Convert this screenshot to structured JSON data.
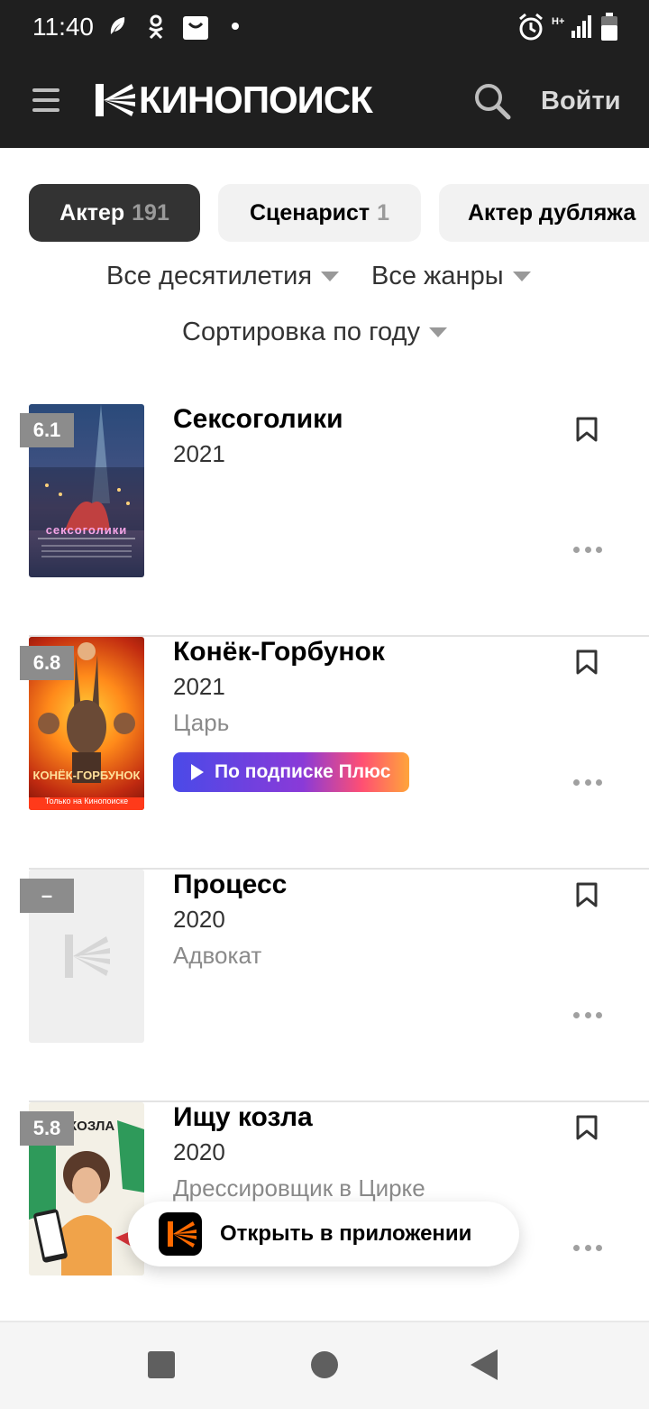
{
  "status_bar": {
    "time": "11:40"
  },
  "header": {
    "logo_text": "КИНОПОИСК",
    "login_label": "Войти",
    "search_icon": "search-icon",
    "menu_icon": "hamburger-icon"
  },
  "tabs": [
    {
      "label": "Актер",
      "count": "191",
      "active": true
    },
    {
      "label": "Сценарист",
      "count": "1",
      "active": false
    },
    {
      "label": "Актер дубляжа",
      "count": "",
      "active": false
    }
  ],
  "filters": {
    "decades": "Все десятилетия",
    "genres": "Все жанры",
    "sort": "Сортировка по году"
  },
  "films": [
    {
      "rating": "6.1",
      "title": "Сексоголики",
      "year": "2021",
      "role": "",
      "badge": ""
    },
    {
      "rating": "6.8",
      "title": "Конёк-Горбунок",
      "year": "2021",
      "role": "Царь",
      "badge": "По подписке Плюс"
    },
    {
      "rating": "–",
      "title": "Процесс",
      "year": "2020",
      "role": "Адвокат",
      "badge": ""
    },
    {
      "rating": "5.8",
      "title": "Ищу козла",
      "year": "2020",
      "role": "Дрессировщик в Цирке",
      "badge": ""
    }
  ],
  "poster_text": {
    "film0": "сексоголики",
    "film1_title": "КОНЁК-ГОРБУНОК",
    "film1_tagline": "Только на Кинопоиске",
    "film3": "КОЗЛА"
  },
  "open_app": {
    "label": "Открыть в приложении"
  },
  "colors": {
    "header_bg": "#1f1f1f",
    "plus_gradient_start": "#4a4ae8",
    "plus_gradient_end": "#ffa53a",
    "brand_orange": "#ff6a00"
  }
}
